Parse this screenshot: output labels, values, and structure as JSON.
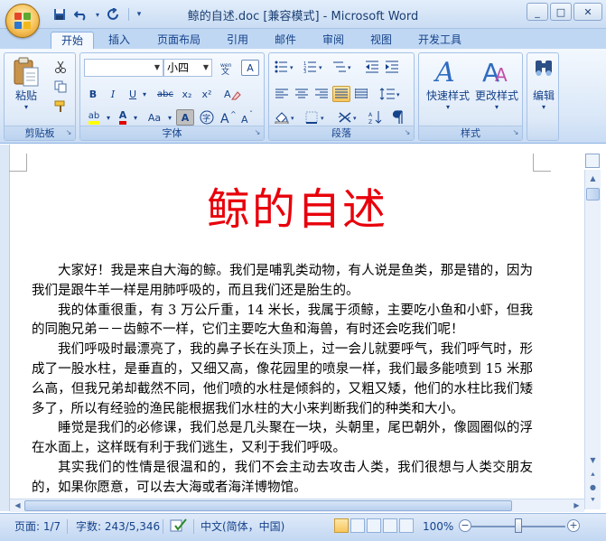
{
  "window": {
    "title": "鲸的自述.doc [兼容模式] - Microsoft Word",
    "minimize": "_",
    "maximize": "□",
    "close": "✕"
  },
  "qat": {
    "save_icon": "save-icon",
    "undo_icon": "undo-icon",
    "redo_icon": "redo-icon",
    "customize": "▾"
  },
  "tabs": [
    {
      "label": "开始"
    },
    {
      "label": "插入"
    },
    {
      "label": "页面布局"
    },
    {
      "label": "引用"
    },
    {
      "label": "邮件"
    },
    {
      "label": "审阅"
    },
    {
      "label": "视图"
    },
    {
      "label": "开发工具"
    }
  ],
  "ribbon": {
    "clipboard": {
      "label": "剪贴板",
      "paste": "粘贴"
    },
    "font": {
      "label": "字体",
      "font_name": "",
      "font_size": "小四",
      "bold": "B",
      "italic": "I",
      "underline": "U",
      "strike": "abc",
      "sub": "x₂",
      "sup": "x²",
      "highlight": "ab",
      "fontcolor": "A",
      "aa": "Aa"
    },
    "paragraph": {
      "label": "段落"
    },
    "styles": {
      "label": "样式",
      "quick": "快速样式",
      "change": "更改样式"
    },
    "editing": {
      "label": "编辑"
    }
  },
  "document": {
    "title": "鲸的自述",
    "paragraphs": [
      "大家好！我是来自大海的鲸。我们是哺乳类动物，有人说是鱼类，那是错的，因为我们是跟牛羊一样是用肺呼吸的，而且我们还是胎生的。",
      "我的体重很重，有 3 万公斤重，14 米长，我属于须鲸，主要吃小鱼和小虾，但我的同胞兄弟－－齿鲸不一样，它们主要吃大鱼和海兽，有时还会吃我们呢！",
      "我们呼吸时最漂亮了，我的鼻子长在头顶上，过一会儿就要呼气，我们呼气时，形成了一股水柱，是垂直的，又细又高，像花园里的喷泉一样，我们最多能喷到 15 米那么高，但我兄弟却截然不同，他们喷的水柱是倾斜的，又粗又矮，他们的水柱比我们矮多了，所以有经验的渔民能根据我们水柱的大小来判断我们的种类和大小。",
      "睡觉是我们的必修课，我们总是几头聚在一块，头朝里，尾巴朝外，像圆圈似的浮在水面上，这样既有利于我们逃生，又利于我们呼吸。",
      "其实我们的性情是很温和的，我们不会主动去攻击人类，我们很想与人类交朋友的，如果你愿意，可以去大海或者海洋博物馆。"
    ]
  },
  "status": {
    "page": "页面: 1/7",
    "words": "字数: 243/5,346",
    "language": "中文(简体，中国)",
    "zoom": "100%"
  }
}
